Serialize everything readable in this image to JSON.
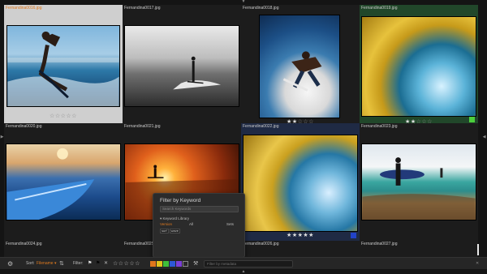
{
  "grid": {
    "rows": [
      [
        {
          "file": "Fernandina0016.jpg",
          "stars": "☆☆☆☆☆",
          "stars_on": ""
        },
        {
          "file": "Fernandina0017.jpg",
          "stars": "",
          "stars_on": ""
        },
        {
          "file": "Fernandina0018.jpg",
          "stars": "☆☆☆",
          "stars_on": "★★"
        },
        {
          "file": "Fernandina0019.jpg",
          "stars": "☆☆☆",
          "stars_on": "★★"
        }
      ],
      [
        {
          "file": "Fernandina0020.jpg"
        },
        {
          "file": "Fernandina0021.jpg"
        },
        {
          "file": "Fernandina0022.jpg",
          "stars": "",
          "stars_on": "★★★★★"
        },
        {
          "file": "Fernandina0023.jpg"
        }
      ],
      [
        {
          "file": "Fernandina0024.jpg"
        },
        {
          "file": "Fernandina0025.jpg"
        },
        {
          "file": "Fernandina0026.jpg"
        },
        {
          "file": "Fernandina0027.jpg"
        }
      ]
    ]
  },
  "colors": {
    "selected_name": "#e07a1f",
    "green_label": "#4ccf3c",
    "blue_label": "#2243c7",
    "orange": "#e0761c",
    "yellow": "#e0c21c",
    "green": "#3fbf3a",
    "blue": "#2d58d6",
    "purple": "#7b3fd6"
  },
  "popup": {
    "title": "Filter by Keyword",
    "search_placeholder": "Search Keywords",
    "library_label": "Keyword Library",
    "col_version": "Version",
    "col_all": "All",
    "col_sets": "Sets",
    "tags": [
      "surf",
      "wave"
    ]
  },
  "toolbar": {
    "sort_label": "Sort:",
    "sort_value": "Filename",
    "filter_label": "Filter:",
    "stars": "☆☆☆☆☆",
    "search_placeholder": "Filter by metadata"
  },
  "icons": {
    "gear": "gear-icon",
    "sort": "sort-direction-icon",
    "flag_white": "flag-icon",
    "flag_black": "reject-flag-icon",
    "tools": "wrench-icon",
    "close": "close-icon"
  }
}
